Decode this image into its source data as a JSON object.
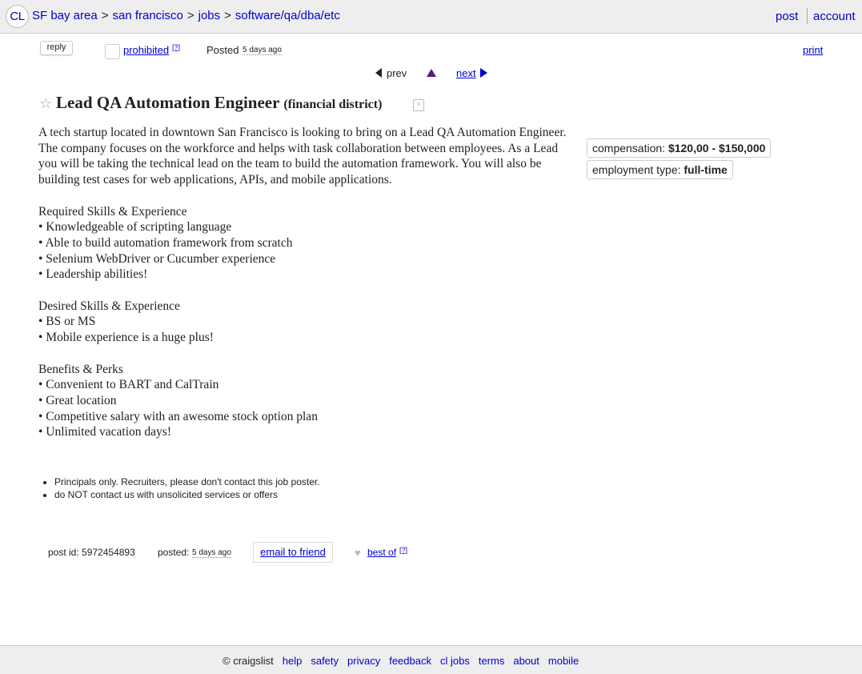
{
  "header": {
    "logo": "CL",
    "breadcrumbs": [
      "SF bay area",
      "san francisco",
      "jobs",
      "software/qa/dba/etc"
    ],
    "separator": ">",
    "post": "post",
    "account": "account"
  },
  "actions": {
    "reply": "reply",
    "prohibited": "prohibited",
    "help_sup": "[?]",
    "posted_label": "Posted",
    "posted_time": "5 days ago",
    "print": "print"
  },
  "nav": {
    "prev": "prev",
    "next": "next"
  },
  "posting": {
    "title": "Lead QA Automation Engineer",
    "hood": "(financial district)",
    "paragraphs": [
      [
        "A tech startup located in downtown San Francisco is looking to bring on a Lead QA Automation Engineer. The company focuses on the workforce and helps with task collaboration between employees. As a Lead you will be taking the technical lead on the team to build the automation framework. You will also be building test cases for web applications, APIs, and mobile applications."
      ],
      [
        "Required Skills & Experience",
        "• Knowledgeable of scripting language",
        "• Able to build automation framework from scratch",
        "• Selenium WebDriver or Cucumber experience",
        "• Leadership abilities!"
      ],
      [
        "Desired Skills & Experience",
        "• BS or MS",
        "• Mobile experience is a huge plus!"
      ],
      [
        "Benefits & Perks",
        "• Convenient to BART and CalTrain",
        "• Great location",
        "• Competitive salary with an awesome stock option plan",
        "• Unlimited vacation days!"
      ]
    ]
  },
  "attributes": {
    "compensation_label": "compensation:",
    "compensation_value": "$120,00 - $150,000",
    "employment_label": "employment type:",
    "employment_value": "full-time"
  },
  "notices": [
    "Principals only. Recruiters, please don't contact this job poster.",
    "do NOT contact us with unsolicited services or offers"
  ],
  "postinfo": {
    "post_id": "post id: 5972454893",
    "posted_label": "posted:",
    "posted_time": "5 days ago",
    "email_friend": "email to friend",
    "best_of": "best of",
    "help_sup": "[?]"
  },
  "footer": {
    "copyright": "© craigslist",
    "links": [
      "help",
      "safety",
      "privacy",
      "feedback",
      "cl jobs",
      "terms",
      "about",
      "mobile"
    ]
  },
  "colors": {
    "link": "#0000cc",
    "visited": "#551a8b",
    "bar": "#eeeeee"
  }
}
